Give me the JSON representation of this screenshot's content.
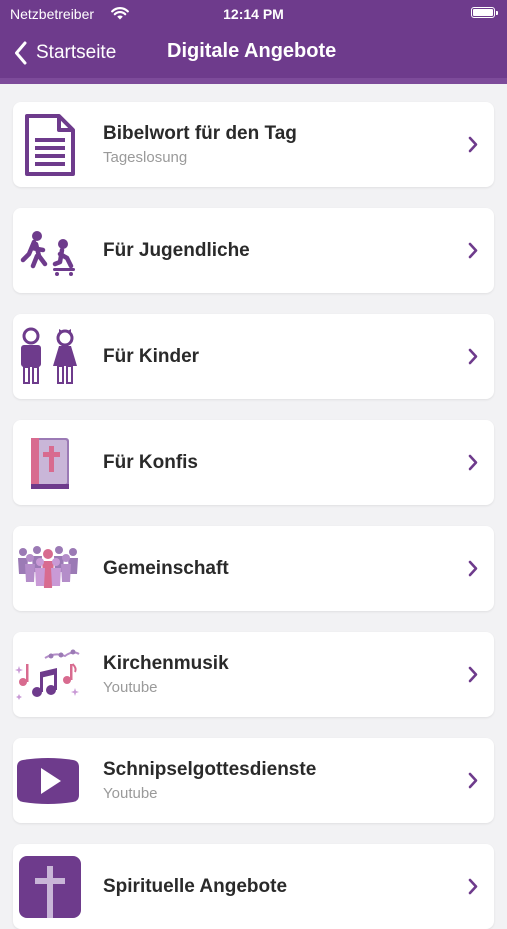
{
  "status_bar": {
    "carrier": "Netzbetreiber",
    "time": "12:14 PM"
  },
  "nav": {
    "back_label": "Startseite",
    "title": "Digitale Angebote"
  },
  "colors": {
    "primary": "#6e3b8c",
    "accent_pink": "#d86b8f",
    "card_bg": "#ffffff",
    "page_bg": "#f2f2f4"
  },
  "items": [
    {
      "title": "Bibelwort für den Tag",
      "subtitle": "Tageslosung",
      "icon": "document-icon"
    },
    {
      "title": "Für Jugendliche",
      "subtitle": "",
      "icon": "youth-icon"
    },
    {
      "title": "Für Kinder",
      "subtitle": "",
      "icon": "children-icon"
    },
    {
      "title": "Für Konfis",
      "subtitle": "",
      "icon": "bible-icon"
    },
    {
      "title": "Gemeinschaft",
      "subtitle": "",
      "icon": "community-icon"
    },
    {
      "title": "Kirchenmusik",
      "subtitle": "Youtube",
      "icon": "music-notes-icon"
    },
    {
      "title": "Schnipselgottesdienste",
      "subtitle": "Youtube",
      "icon": "video-play-icon"
    },
    {
      "title": "Spirituelle Angebote",
      "subtitle": "",
      "icon": "cross-icon"
    }
  ]
}
